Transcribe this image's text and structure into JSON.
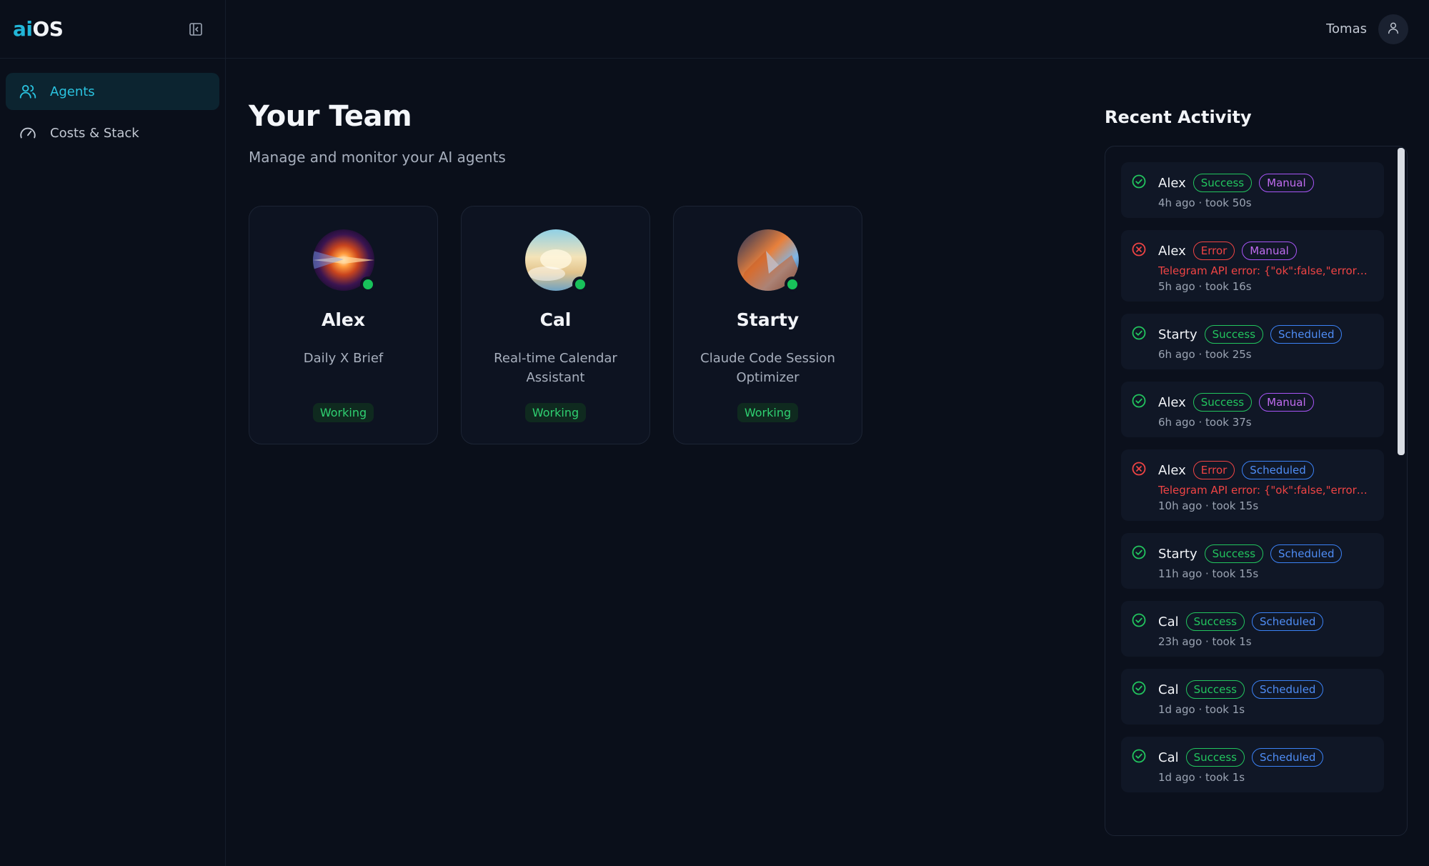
{
  "brand": {
    "logo_ai": "ai",
    "logo_os": "OS"
  },
  "sidebar": {
    "items": [
      {
        "label": "Agents",
        "icon": "users-icon",
        "active": true
      },
      {
        "label": "Costs & Stack",
        "icon": "gauge-icon",
        "active": false
      }
    ]
  },
  "header": {
    "user_name": "Tomas"
  },
  "main": {
    "title": "Your Team",
    "subtitle": "Manage and monitor your AI agents",
    "agents": [
      {
        "name": "Alex",
        "description": "Daily X Brief",
        "status": "Working",
        "online": true
      },
      {
        "name": "Cal",
        "description": "Real-time Calendar Assistant",
        "status": "Working",
        "online": true
      },
      {
        "name": "Starty",
        "description": "Claude Code Session Optimizer",
        "status": "Working",
        "online": true
      }
    ]
  },
  "activity": {
    "title": "Recent Activity",
    "items": [
      {
        "agent": "Alex",
        "result": "Success",
        "trigger": "Manual",
        "error": "",
        "meta": "4h ago · took 50s"
      },
      {
        "agent": "Alex",
        "result": "Error",
        "trigger": "Manual",
        "error": "Telegram API error: {\"ok\":false,\"error_co...",
        "meta": "5h ago · took 16s"
      },
      {
        "agent": "Starty",
        "result": "Success",
        "trigger": "Scheduled",
        "error": "",
        "meta": "6h ago · took 25s"
      },
      {
        "agent": "Alex",
        "result": "Success",
        "trigger": "Manual",
        "error": "",
        "meta": "6h ago · took 37s"
      },
      {
        "agent": "Alex",
        "result": "Error",
        "trigger": "Scheduled",
        "error": "Telegram API error: {\"ok\":false,\"error_co...",
        "meta": "10h ago · took 15s"
      },
      {
        "agent": "Starty",
        "result": "Success",
        "trigger": "Scheduled",
        "error": "",
        "meta": "11h ago · took 15s"
      },
      {
        "agent": "Cal",
        "result": "Success",
        "trigger": "Scheduled",
        "error": "",
        "meta": "23h ago · took 1s"
      },
      {
        "agent": "Cal",
        "result": "Success",
        "trigger": "Scheduled",
        "error": "",
        "meta": "1d ago · took 1s"
      },
      {
        "agent": "Cal",
        "result": "Success",
        "trigger": "Scheduled",
        "error": "",
        "meta": "1d ago · took 1s"
      }
    ]
  },
  "colors": {
    "accent": "#22b6d8",
    "success": "#22c55e",
    "error": "#ef4444",
    "manual": "#a855f7",
    "scheduled": "#3b82f6"
  }
}
